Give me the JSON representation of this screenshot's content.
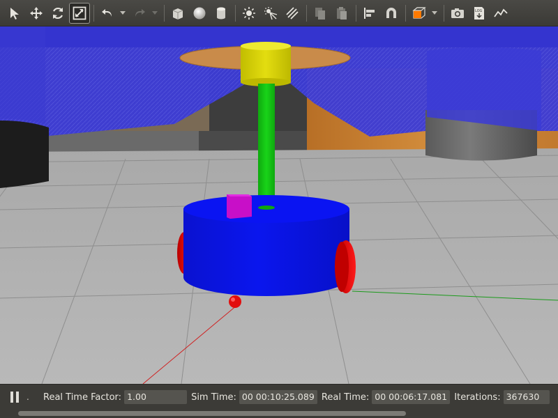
{
  "toolbar": {
    "tools": [
      {
        "name": "select-mode-icon"
      },
      {
        "name": "translate-mode-icon"
      },
      {
        "name": "rotate-mode-icon"
      },
      {
        "name": "scale-mode-icon",
        "active": true
      },
      {
        "name": "undo-icon"
      },
      {
        "name": "redo-icon"
      },
      {
        "name": "box-shape-icon"
      },
      {
        "name": "sphere-shape-icon"
      },
      {
        "name": "cylinder-shape-icon"
      },
      {
        "name": "point-light-icon"
      },
      {
        "name": "spot-light-icon"
      },
      {
        "name": "directional-light-icon"
      },
      {
        "name": "copy-icon"
      },
      {
        "name": "paste-icon"
      },
      {
        "name": "align-icon"
      },
      {
        "name": "snap-icon"
      },
      {
        "name": "view-angle-icon"
      },
      {
        "name": "screenshot-icon"
      },
      {
        "name": "log-icon"
      },
      {
        "name": "plot-icon"
      }
    ],
    "log_icon_text": "LOG"
  },
  "colors": {
    "sky": "#3a3ad4",
    "floor": "#b4b4b4",
    "robot_body": "#0a14e6",
    "wheels": "#e60a0a",
    "column": "#13c813",
    "cap": "#d9d300",
    "sensor_box": "#d214d2"
  },
  "status": {
    "real_time_factor_label": "Real Time Factor:",
    "real_time_factor": "1.00",
    "sim_time_label": "Sim Time:",
    "sim_time": "00 00:10:25.089",
    "real_time_label": "Real Time:",
    "real_time": "00 00:06:17.081",
    "iterations_label": "Iterations:",
    "iterations": "367630",
    "step_indicator": "."
  }
}
